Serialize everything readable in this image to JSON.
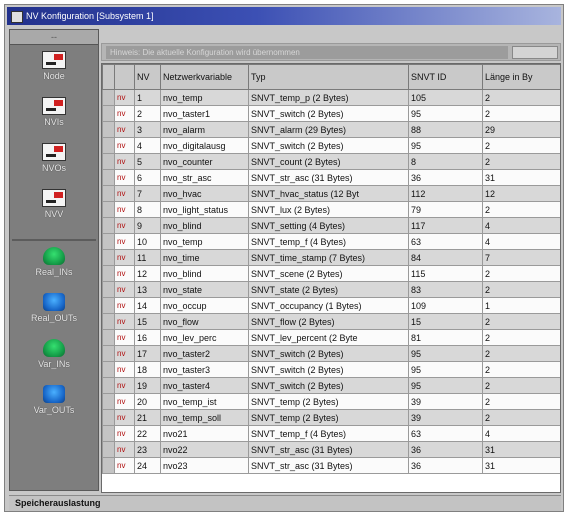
{
  "window": {
    "title": "NV Konfiguration [Subsystem 1]"
  },
  "sidebar": {
    "corner": "--",
    "items": [
      {
        "label": "Node",
        "icon": "node-icon"
      },
      {
        "label": "NVIs",
        "icon": "nvi-icon"
      },
      {
        "label": "NVOs",
        "icon": "nvo-icon"
      },
      {
        "label": "NVV",
        "icon": "nvv-icon"
      },
      {
        "label": "Real_INs",
        "icon": "real-in-icon"
      },
      {
        "label": "Real_OUTs",
        "icon": "real-out-icon"
      },
      {
        "label": "Var_INs",
        "icon": "var-in-icon"
      },
      {
        "label": "Var_OUTs",
        "icon": "var-out-icon"
      }
    ]
  },
  "infobar": {
    "message": "Hinweis: Die aktuelle Konfiguration wird übernommen"
  },
  "grid": {
    "columns": [
      "",
      "",
      "NV",
      "Netzwerkvariable",
      "Typ",
      "SNVT ID",
      "Länge in By"
    ],
    "rows": [
      [
        "",
        "nv",
        "1",
        "nvo_temp",
        "SNVT_temp_p (2 Bytes)",
        "105",
        "2"
      ],
      [
        "",
        "nv",
        "2",
        "nvo_taster1",
        "SNVT_switch (2 Bytes)",
        "95",
        "2"
      ],
      [
        "",
        "nv",
        "3",
        "nvo_alarm",
        "SNVT_alarm (29 Bytes)",
        "88",
        "29"
      ],
      [
        "",
        "nv",
        "4",
        "nvo_digitalausg",
        "SNVT_switch (2 Bytes)",
        "95",
        "2"
      ],
      [
        "",
        "nv",
        "5",
        "nvo_counter",
        "SNVT_count (2 Bytes)",
        "8",
        "2"
      ],
      [
        "",
        "nv",
        "6",
        "nvo_str_asc",
        "SNVT_str_asc (31 Bytes)",
        "36",
        "31"
      ],
      [
        "",
        "nv",
        "7",
        "nvo_hvac",
        "SNVT_hvac_status (12 Byt",
        "112",
        "12"
      ],
      [
        "",
        "nv",
        "8",
        "nvo_light_status",
        "SNVT_lux (2 Bytes)",
        "79",
        "2"
      ],
      [
        "",
        "nv",
        "9",
        "nvo_blind",
        "SNVT_setting (4 Bytes)",
        "117",
        "4"
      ],
      [
        "",
        "nv",
        "10",
        "nvo_temp",
        "SNVT_temp_f (4 Bytes)",
        "63",
        "4"
      ],
      [
        "",
        "nv",
        "11",
        "nvo_time",
        "SNVT_time_stamp (7 Bytes)",
        "84",
        "7"
      ],
      [
        "",
        "nv",
        "12",
        "nvo_blind",
        "SNVT_scene (2 Bytes)",
        "115",
        "2"
      ],
      [
        "",
        "nv",
        "13",
        "nvo_state",
        "SNVT_state (2 Bytes)",
        "83",
        "2"
      ],
      [
        "",
        "nv",
        "14",
        "nvo_occup",
        "SNVT_occupancy (1 Bytes)",
        "109",
        "1"
      ],
      [
        "",
        "nv",
        "15",
        "nvo_flow",
        "SNVT_flow (2 Bytes)",
        "15",
        "2"
      ],
      [
        "",
        "nv",
        "16",
        "nvo_lev_perc",
        "SNVT_lev_percent (2 Byte",
        "81",
        "2"
      ],
      [
        "",
        "nv",
        "17",
        "nvo_taster2",
        "SNVT_switch (2 Bytes)",
        "95",
        "2"
      ],
      [
        "",
        "nv",
        "18",
        "nvo_taster3",
        "SNVT_switch (2 Bytes)",
        "95",
        "2"
      ],
      [
        "",
        "nv",
        "19",
        "nvo_taster4",
        "SNVT_switch (2 Bytes)",
        "95",
        "2"
      ],
      [
        "",
        "nv",
        "20",
        "nvo_temp_ist",
        "SNVT_temp (2 Bytes)",
        "39",
        "2"
      ],
      [
        "",
        "nv",
        "21",
        "nvo_temp_soll",
        "SNVT_temp (2 Bytes)",
        "39",
        "2"
      ],
      [
        "",
        "nv",
        "22",
        "nvo21",
        "SNVT_temp_f (4 Bytes)",
        "63",
        "4"
      ],
      [
        "",
        "nv",
        "23",
        "nvo22",
        "SNVT_str_asc (31 Bytes)",
        "36",
        "31"
      ],
      [
        "",
        "nv",
        "24",
        "nvo23",
        "SNVT_str_asc (31 Bytes)",
        "36",
        "31"
      ]
    ]
  },
  "status": {
    "text": "Speicherauslastung"
  }
}
